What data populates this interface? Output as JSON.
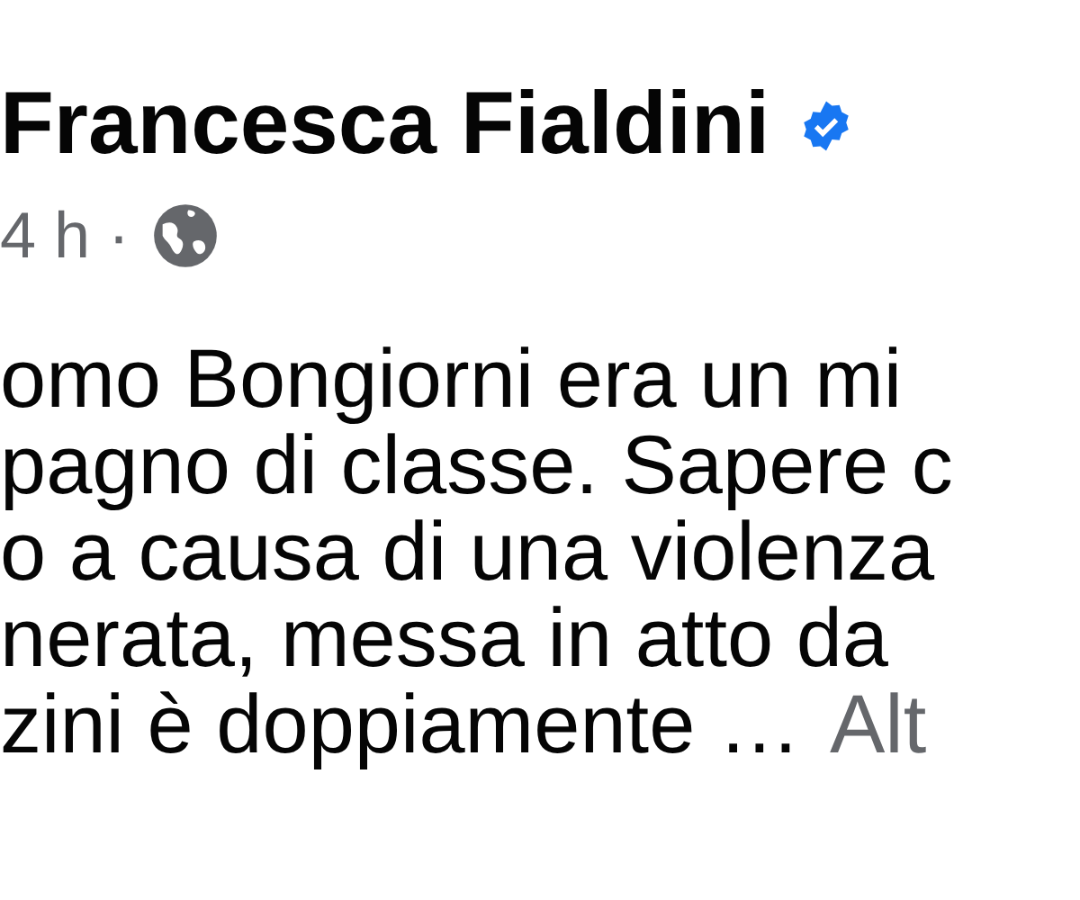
{
  "post": {
    "author": "Francesca Fialdini",
    "verified": true,
    "time": "4 h ·",
    "lines": [
      "omo Bongiorni era un mi",
      "pagno di classe. Sapere c",
      "o a causa di una violenza",
      "nerata, messa in atto da",
      "zini è doppiamente …"
    ],
    "more_link": "Alt"
  }
}
